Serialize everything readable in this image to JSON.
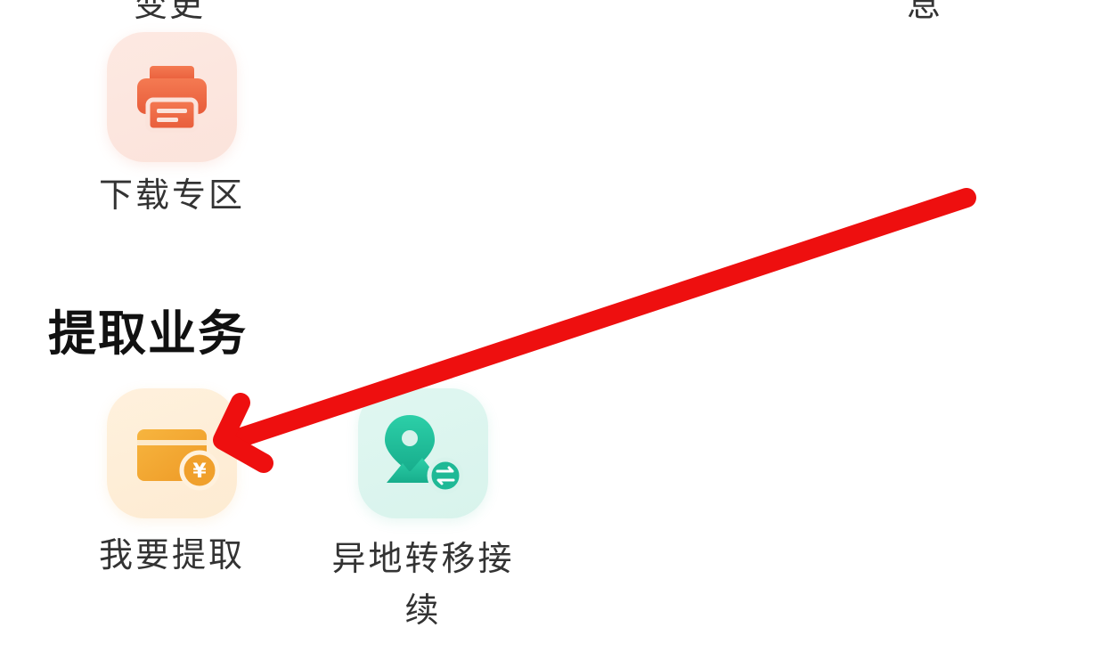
{
  "top_cut_labels": {
    "left": "变更",
    "right": "息"
  },
  "download_section": {
    "item": {
      "label": "下载专区",
      "icon": "printer-icon",
      "icon_color": "#ee6a45"
    }
  },
  "withdraw_section": {
    "title": "提取业务",
    "items": [
      {
        "label": "我要提取",
        "icon": "card-yuan-icon",
        "icon_color": "#f2a733"
      },
      {
        "label": "异地转移接续",
        "icon": "location-transfer-icon",
        "icon_color": "#1fb996"
      }
    ]
  },
  "annotation": {
    "type": "red-arrow",
    "color": "#ee0f0f",
    "points_to": "我要提取"
  }
}
